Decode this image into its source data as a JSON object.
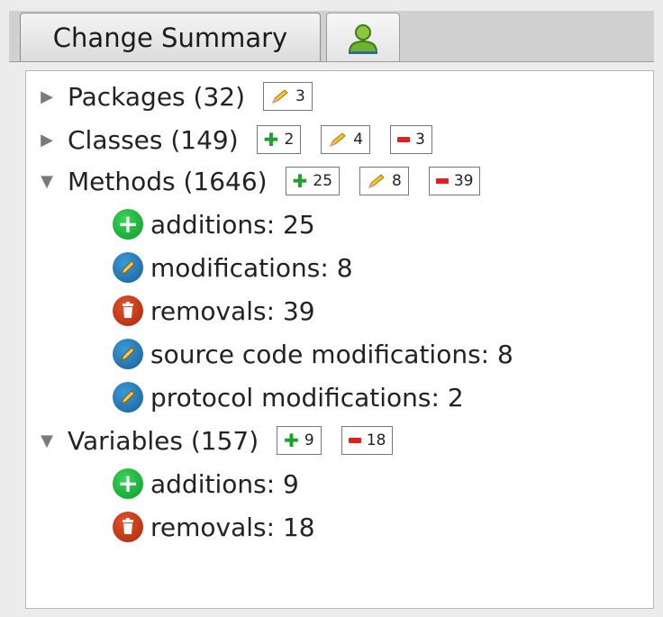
{
  "tabs": {
    "active_label": "Change Summary",
    "user_tab_icon": "user-icon"
  },
  "tree": {
    "packages": {
      "label": "Packages (32)",
      "expanded": false,
      "modified": "3"
    },
    "classes": {
      "label": "Classes (149)",
      "expanded": false,
      "added": "2",
      "modified": "4",
      "removed": "3"
    },
    "methods": {
      "label": "Methods (1646)",
      "expanded": true,
      "added": "25",
      "modified": "8",
      "removed": "39",
      "children": [
        {
          "text": "additions:  25",
          "icon": "add-icon"
        },
        {
          "text": "modifications:  8",
          "icon": "pencil-icon"
        },
        {
          "text": "removals:  39",
          "icon": "trash-icon"
        },
        {
          "text": "source code modifications:  8",
          "icon": "pencil-icon"
        },
        {
          "text": "protocol modifications:  2",
          "icon": "pencil-icon"
        }
      ]
    },
    "variables": {
      "label": "Variables (157)",
      "expanded": true,
      "added": "9",
      "removed": "18",
      "children": [
        {
          "text": "additions:  9",
          "icon": "add-icon"
        },
        {
          "text": "removals:  18",
          "icon": "trash-icon"
        }
      ]
    }
  },
  "colors": {
    "add": "#1fa02c",
    "remove": "#e02020",
    "modify_icon": "#2a7ab8",
    "remove_icon": "#c0391b"
  }
}
